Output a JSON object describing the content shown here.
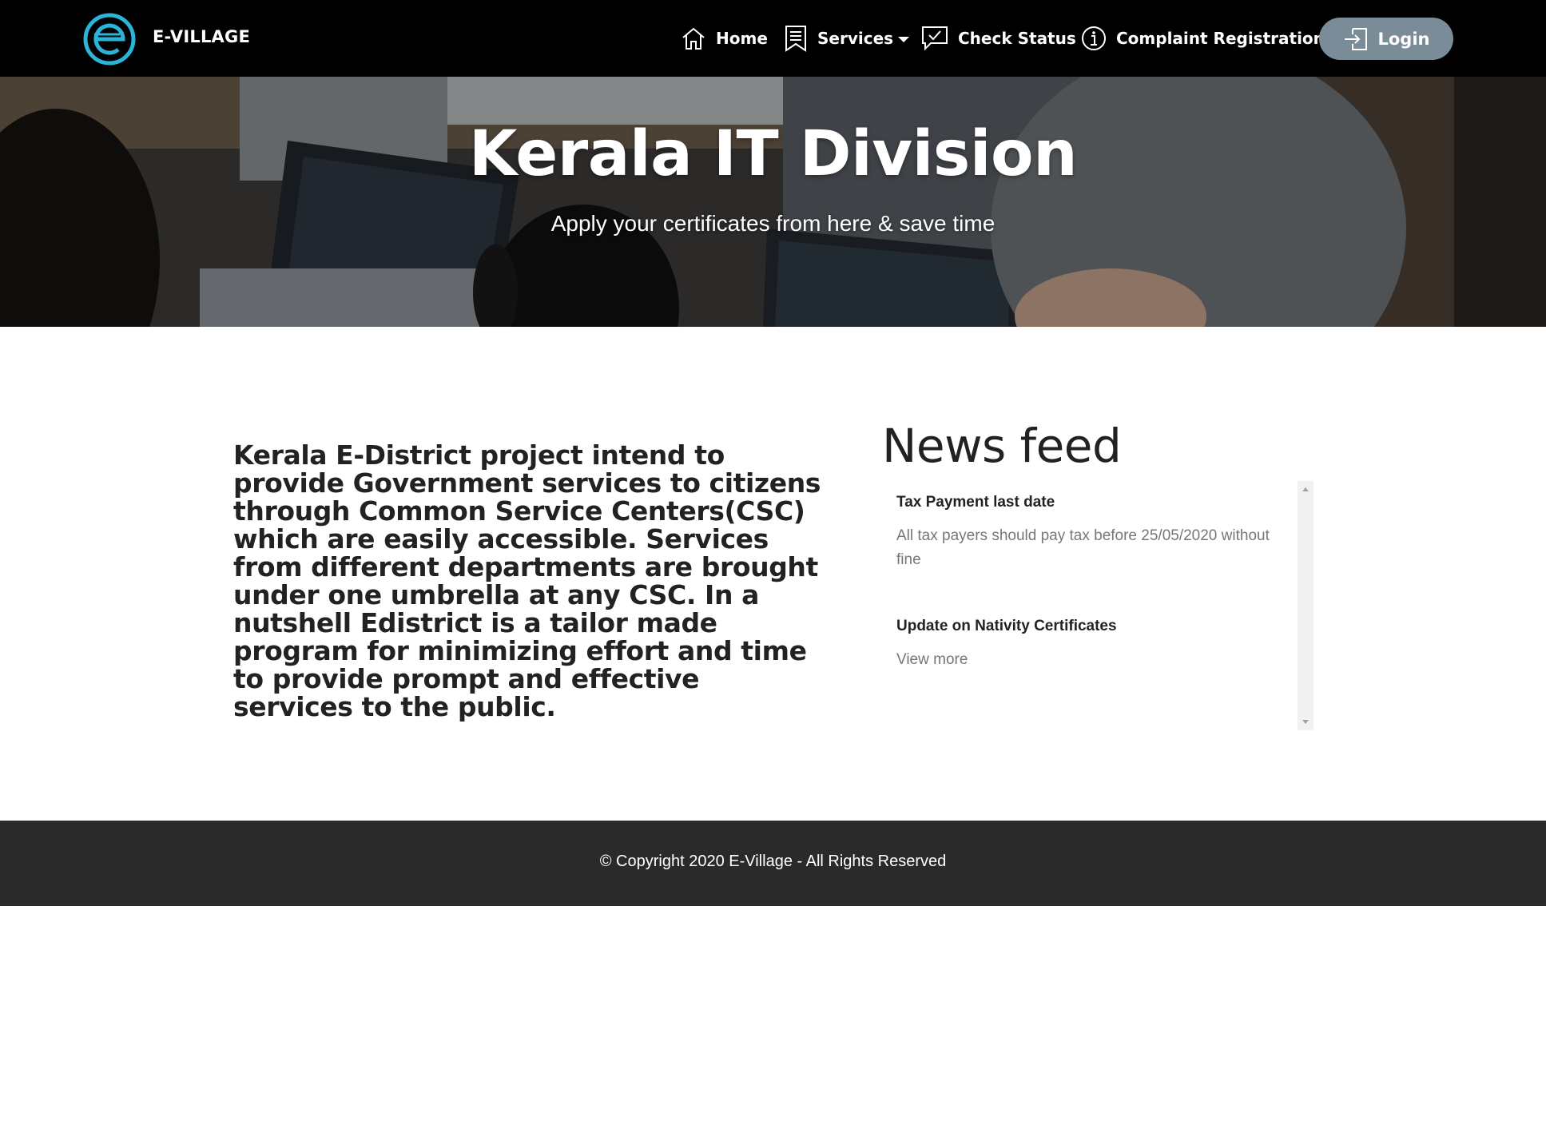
{
  "navbar": {
    "brand": "E-VILLAGE",
    "logo_icon": "e-logo-icon",
    "items": [
      {
        "label": "Home",
        "icon": "home-icon"
      },
      {
        "label": "Services",
        "icon": "services-icon"
      },
      {
        "label": "Check Status",
        "icon": "check-status-icon"
      },
      {
        "label": "Complaint Registration",
        "icon": "info-icon"
      }
    ],
    "login_label": "Login",
    "login_icon": "login-icon"
  },
  "hero": {
    "title": "Kerala IT Division",
    "subtitle": "Apply your certificates from here & save time"
  },
  "about": {
    "text": "Kerala E-District project intend to provide Government services to citizens through Common Service Centers(CSC) which are easily accessible. Services from different departments are brought under one umbrella at any CSC. In a nutshell Edistrict is a tailor made program for minimizing effort and time to provide prompt and effective services to the public."
  },
  "news": {
    "title": "News feed",
    "items": [
      {
        "title": "Tax Payment last date",
        "body": "All tax payers should pay tax before 25/05/2020 without fine"
      },
      {
        "title": "Update on Nativity Certificates",
        "body": "View more"
      }
    ]
  },
  "footer": {
    "text": "© Copyright 2020 E-Village - All Rights Reserved"
  },
  "colors": {
    "navbar_bg": "#000000",
    "logo_accent": "#2bb3d8",
    "login_bg": "#7a8c97",
    "footer_bg": "#2a2a2a"
  }
}
